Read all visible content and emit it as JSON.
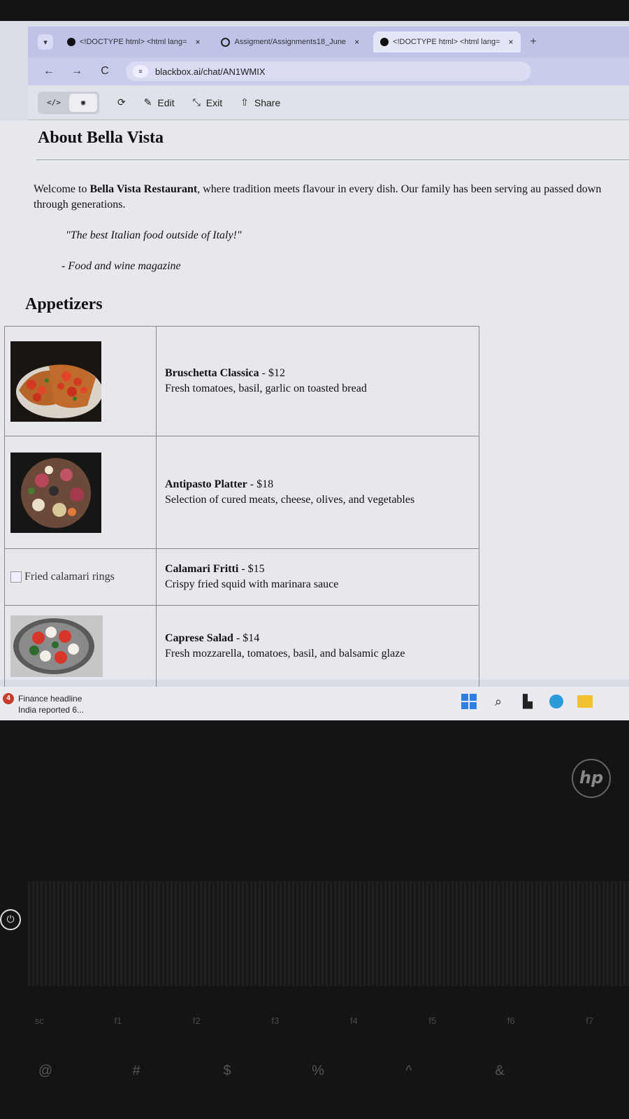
{
  "browser": {
    "tabs": [
      {
        "title": "<!DOCTYPE html> <html lang=",
        "active": false,
        "icon": "dot"
      },
      {
        "title": "Assigment/Assignments18_June",
        "active": false,
        "icon": "github"
      },
      {
        "title": "<!DOCTYPE html> <html lang=",
        "active": true,
        "icon": "dot"
      }
    ],
    "close_glyph": "×",
    "new_tab_glyph": "+",
    "url": "blackbox.ai/chat/AN1WMIX",
    "toolbar": {
      "code_glyph": "</>",
      "preview_glyph": "◉",
      "refresh_glyph": "⟳",
      "edit_label": "Edit",
      "exit_label": "Exit",
      "share_label": "Share"
    }
  },
  "page": {
    "about_heading": "About Bella Vista",
    "intro_pre": "Welcome to ",
    "intro_bold": "Bella Vista Restaurant",
    "intro_post": ", where tradition meets flavour in every dish. Our family has been serving au passed down through generations.",
    "quote": "\"The best Italian food outside of Italy!\"",
    "cite": "- Food and wine magazine",
    "section_heading": "Appetizers",
    "dishes": [
      {
        "name": "Bruschetta Classica",
        "price": " - $12",
        "description": "Fresh tomatoes, basil, garlic on toasted bread",
        "image_alt": ""
      },
      {
        "name": "Antipasto Platter",
        "price": " - $18",
        "description": "Selection of cured meats, cheese, olives, and vegetables",
        "image_alt": ""
      },
      {
        "name": "Calamari Fritti",
        "price": " - $15",
        "description": "Crispy fried squid with marinara sauce",
        "image_alt": "Fried calamari rings"
      },
      {
        "name": "Caprese Salad",
        "price": " - $14",
        "description": "Fresh mozzarella, tomatoes, basil, and balsamic glaze",
        "image_alt": ""
      }
    ]
  },
  "taskbar": {
    "news_badge": "4",
    "news_title": "Finance headline",
    "news_subtitle": "India reported 6..."
  },
  "keyboard": {
    "brand": "hp",
    "fkeys": [
      "sc",
      "f1",
      "f2",
      "f3",
      "f4",
      "f5",
      "f6",
      "f7"
    ],
    "numkeys": [
      "@",
      "#",
      "$",
      "%",
      "^",
      "&"
    ]
  }
}
